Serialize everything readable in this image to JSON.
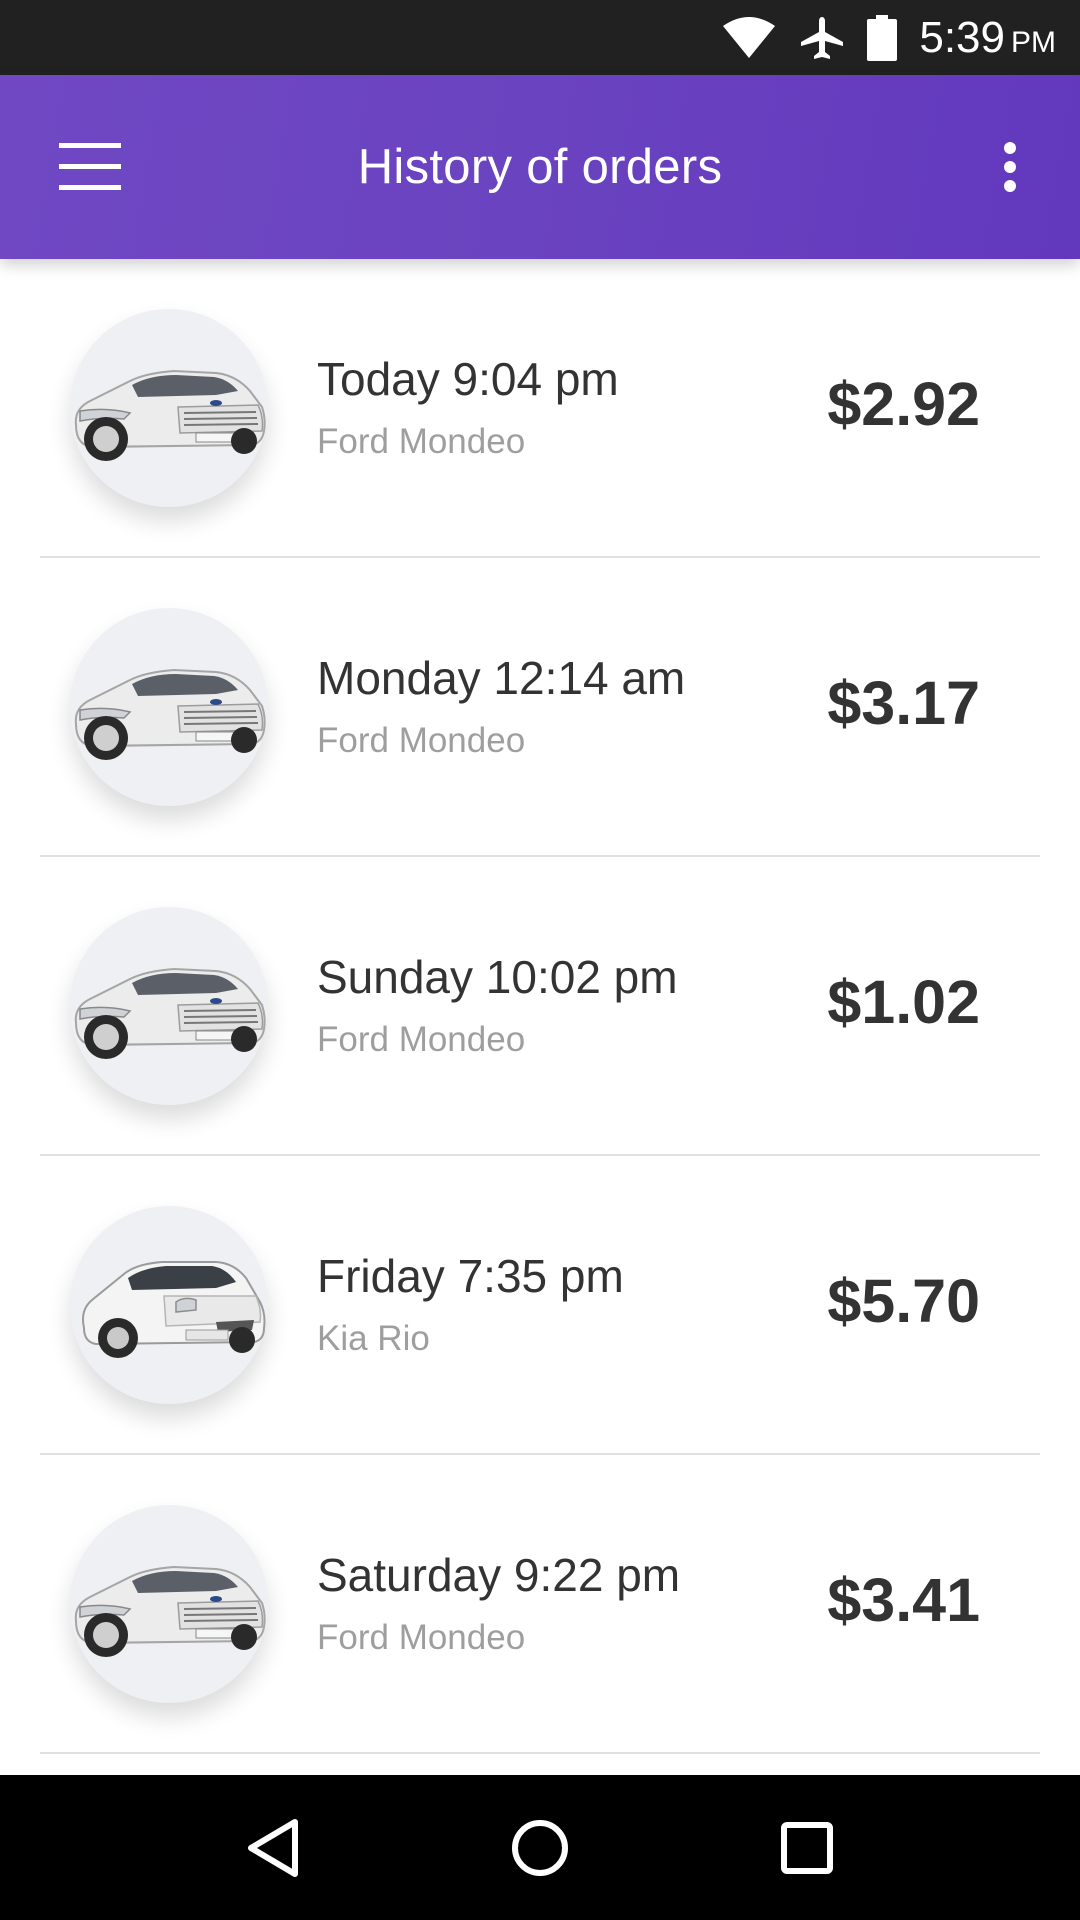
{
  "status_bar": {
    "time": "5:39",
    "ampm": "PM",
    "icons": [
      "wifi-icon",
      "airplane-icon",
      "battery-icon"
    ]
  },
  "app_bar": {
    "title": "History of orders",
    "left_icon": "menu-icon",
    "right_icon": "more-vert-icon",
    "gradient_colors": [
      "#7048c4",
      "#6238bd"
    ]
  },
  "orders": [
    {
      "time": "Today 9:04 pm",
      "car": "Ford Mondeo",
      "price": "$2.92",
      "car_model": "mondeo"
    },
    {
      "time": "Monday 12:14 am",
      "car": "Ford Mondeo",
      "price": "$3.17",
      "car_model": "mondeo"
    },
    {
      "time": "Sunday 10:02 pm",
      "car": "Ford Mondeo",
      "price": "$1.02",
      "car_model": "mondeo"
    },
    {
      "time": "Friday 7:35 pm",
      "car": "Kia Rio",
      "price": "$5.70",
      "car_model": "rio"
    },
    {
      "time": "Saturday 9:22 pm",
      "car": "Ford Mondeo",
      "price": "$3.41",
      "car_model": "mondeo"
    }
  ],
  "nav_bar": {
    "icons": [
      "back-icon",
      "home-icon",
      "recents-icon"
    ]
  },
  "colors": {
    "accent": "#6a43c0",
    "text_primary": "#333333",
    "text_secondary": "#9e9e9e",
    "divider": "#e0e0e0"
  }
}
